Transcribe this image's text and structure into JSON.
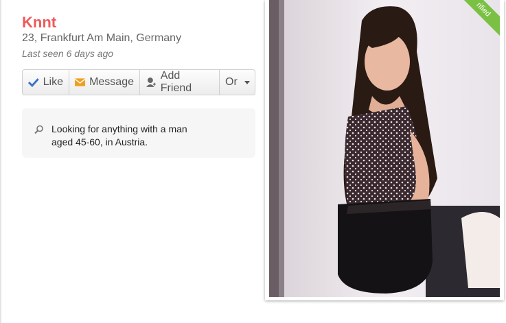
{
  "profile": {
    "name": "Knnt",
    "location": "23, Frankfurt Am Main, Germany",
    "last_seen": "Last seen 6 days ago"
  },
  "actions": {
    "like_label": "Like",
    "message_label": "Message",
    "add_friend_label": "Add Friend",
    "or_label": "Or"
  },
  "intro": {
    "text": "Looking for anything with a man aged 45-60, in Austria."
  },
  "photo": {
    "badge": "rified"
  },
  "colors": {
    "name": "#ee5a5a",
    "verified": "#7ac143",
    "like_check": "#3b73c8",
    "message_icon": "#f0a020"
  }
}
